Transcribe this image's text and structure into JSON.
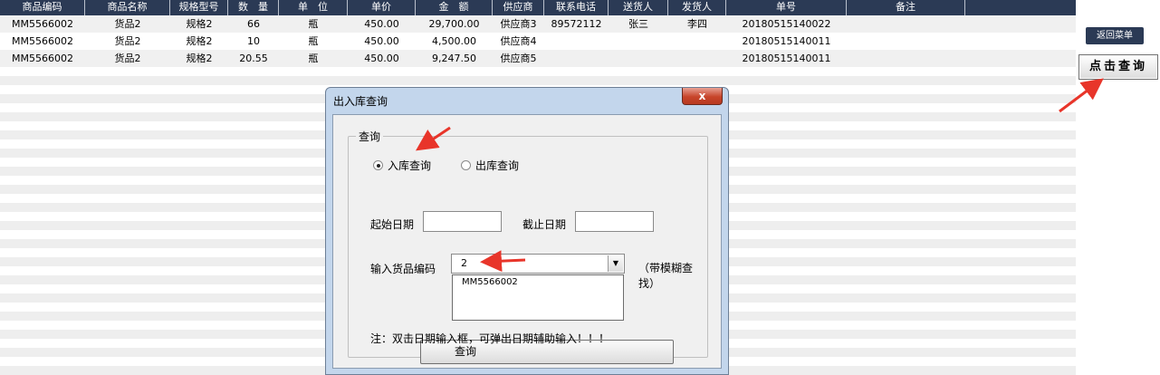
{
  "table": {
    "headers": [
      "商品编码",
      "商品名称",
      "规格型号",
      "数　量",
      "单　位",
      "单价",
      "金　额",
      "供应商",
      "联系电话",
      "送货人",
      "发货人",
      "单号",
      "备注",
      ""
    ],
    "rows": [
      [
        "MM5566002",
        "货品2",
        "规格2",
        "66",
        "瓶",
        "450.00",
        "29,700.00",
        "供应商3",
        "89572112",
        "张三",
        "李四",
        "20180515140022",
        ""
      ],
      [
        "MM5566002",
        "货品2",
        "规格2",
        "10",
        "瓶",
        "450.00",
        "4,500.00",
        "供应商4",
        "",
        "",
        "",
        "20180515140011",
        ""
      ],
      [
        "MM5566002",
        "货品2",
        "规格2",
        "20.55",
        "瓶",
        "450.00",
        "9,247.50",
        "供应商5",
        "",
        "",
        "",
        "20180515140011",
        ""
      ]
    ]
  },
  "side": {
    "menu_button": "返回菜单",
    "query_button": "点击查询"
  },
  "dialog": {
    "title": "出入库查询",
    "close": "x",
    "group_label": "查询",
    "radio_in": "入库查询",
    "radio_out": "出库查询",
    "start_date_label": "起始日期",
    "end_date_label": "截止日期",
    "start_date_value": "",
    "end_date_value": "",
    "code_label": "输入货品编码",
    "code_value": "2",
    "fuzzy_hint": "（带模糊查找）",
    "dropdown_option": "MM5566002",
    "query_button": "查询",
    "note": "注：双击日期输入框，可弹出日期辅助输入！！！"
  },
  "colors": {
    "header_bg": "#2b3a55",
    "stripe": "#eeeeee",
    "dialog_frame": "#c3d6ec",
    "close_button": "#c7442a",
    "arrow": "#e8352a"
  }
}
